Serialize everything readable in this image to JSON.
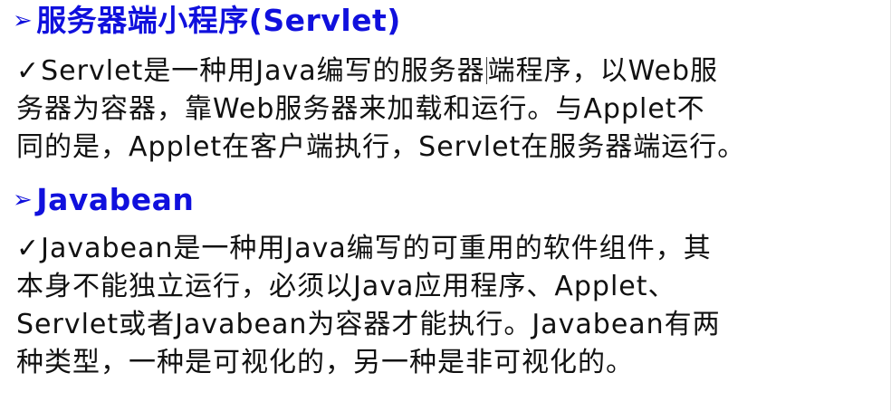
{
  "sections": [
    {
      "marker": "➢",
      "title": "服务器端小程序(Servlet)",
      "bullet": "✓",
      "lines": [
        [
          "Servlet是一种用Java编写的服务器",
          "端程序，以Web服"
        ],
        [
          "务器为容器，靠Web服务器来加载和运行。与Applet不"
        ],
        [
          "同的是，Applet在客户端执行，Servlet在服务器端运行。"
        ]
      ]
    },
    {
      "marker": "➢",
      "title": "Javabean",
      "bullet": "✓",
      "lines": [
        [
          "Javabean是一种用Java编写的可重用的软件组件，其"
        ],
        [
          "本身不能独立运行，必须以Java应用程序、Applet、"
        ],
        [
          "Servlet或者Javabean为容器才能执行。Javabean有两"
        ],
        [
          "种类型，一种是可视化的，另一种是非可视化的。"
        ]
      ]
    }
  ],
  "colors": {
    "heading": "#1010dd",
    "text": "#111111",
    "background": "#ffffff"
  }
}
